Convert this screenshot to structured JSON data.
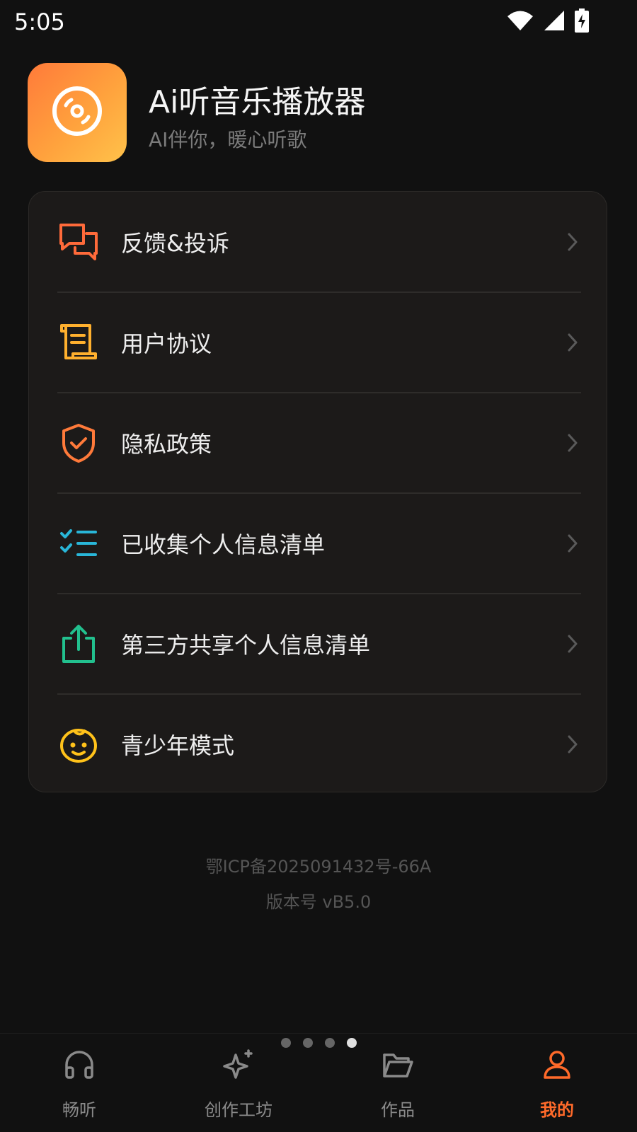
{
  "status_bar": {
    "time": "5:05"
  },
  "header": {
    "app_name": "Ai听音乐播放器",
    "tagline": "AI伴你，暖心听歌"
  },
  "menu": {
    "items": [
      {
        "label": "反馈&投诉",
        "icon": "chat-bubbles-icon",
        "color": "#ff6a3a"
      },
      {
        "label": "用户协议",
        "icon": "scroll-icon",
        "color": "#ffb02e"
      },
      {
        "label": "隐私政策",
        "icon": "shield-check-icon",
        "color": "#ff7a3a"
      },
      {
        "label": "已收集个人信息清单",
        "icon": "checklist-icon",
        "color": "#29b6d8"
      },
      {
        "label": "第三方共享个人信息清单",
        "icon": "share-upload-icon",
        "color": "#22c08e"
      },
      {
        "label": "青少年模式",
        "icon": "child-face-icon",
        "color": "#ffc21a"
      }
    ]
  },
  "footer": {
    "icp": "鄂ICP备2025091432号-66A",
    "version": "版本号 vB5.0"
  },
  "pager": {
    "count": 4,
    "active_index": 3
  },
  "bottom_nav": {
    "active_color": "#ff6a2a",
    "tabs": [
      {
        "label": "畅听",
        "icon": "headphones-icon"
      },
      {
        "label": "创作工坊",
        "icon": "sparkle-icon"
      },
      {
        "label": "作品",
        "icon": "folder-icon"
      },
      {
        "label": "我的",
        "icon": "user-icon",
        "active": true
      }
    ]
  }
}
